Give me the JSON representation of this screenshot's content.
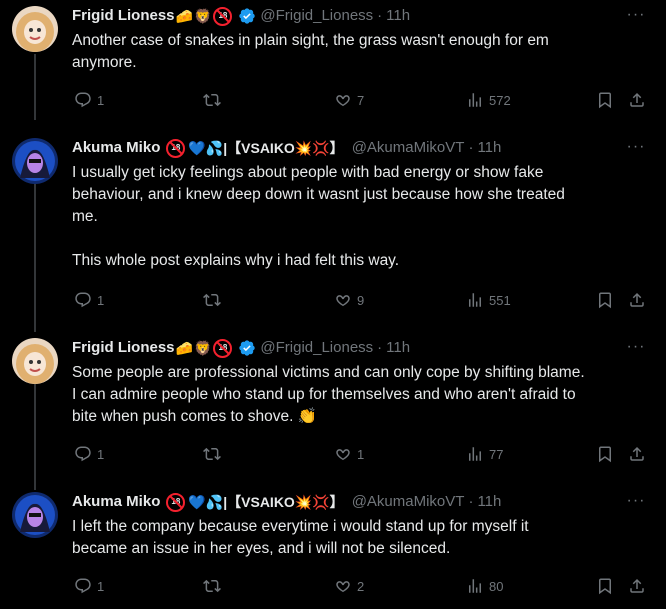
{
  "tweets": [
    {
      "name": "Frigid Lioness",
      "name_emojis": [
        "🧀",
        "🦁"
      ],
      "handle": "@Frigid_Lioness",
      "separator": "·",
      "time": "11h",
      "text": "Another case of snakes in plain sight, the grass wasn't enough for em\nanymore.",
      "replies": "1",
      "reposts": "",
      "likes": "7",
      "views": "572",
      "verified": true
    },
    {
      "name": "Akuma Miko",
      "name_extra": "💙💦|【VSAIKO💥💢】",
      "handle": "@AkumaMikoVT",
      "separator": "·",
      "time": "11h",
      "text": "I usually get icky feelings about people with bad energy or show fake\nbehaviour, and i knew deep down it wasnt just because how she treated\nme.\n\nThis whole post explains why i had felt this way.",
      "replies": "1",
      "reposts": "",
      "likes": "9",
      "views": "551",
      "verified": false
    },
    {
      "name": "Frigid Lioness",
      "name_emojis": [
        "🧀",
        "🦁"
      ],
      "handle": "@Frigid_Lioness",
      "separator": "·",
      "time": "11h",
      "text": "Some people are professional victims and can only cope by shifting blame.\nI can admire people who stand up for themselves and who aren't afraid to\nbite when push comes to shove. 👏",
      "replies": "1",
      "reposts": "",
      "likes": "1",
      "views": "77",
      "verified": true
    },
    {
      "name": "Akuma Miko",
      "name_extra": "💙💦|【VSAIKO💥💢】",
      "handle": "@AkumaMikoVT",
      "separator": "·",
      "time": "11h",
      "text": "I left the company because everytime i would stand up for myself it\nbecame an issue in her eyes, and i will not be silenced.",
      "replies": "1",
      "reposts": "",
      "likes": "2",
      "views": "80",
      "verified": false
    }
  ],
  "badge_18": "18",
  "colors": {
    "background": "#000000",
    "text": "#e7e9ea",
    "muted": "#71767b",
    "verified": "#1d9bf0",
    "thread_line": "#333639"
  }
}
